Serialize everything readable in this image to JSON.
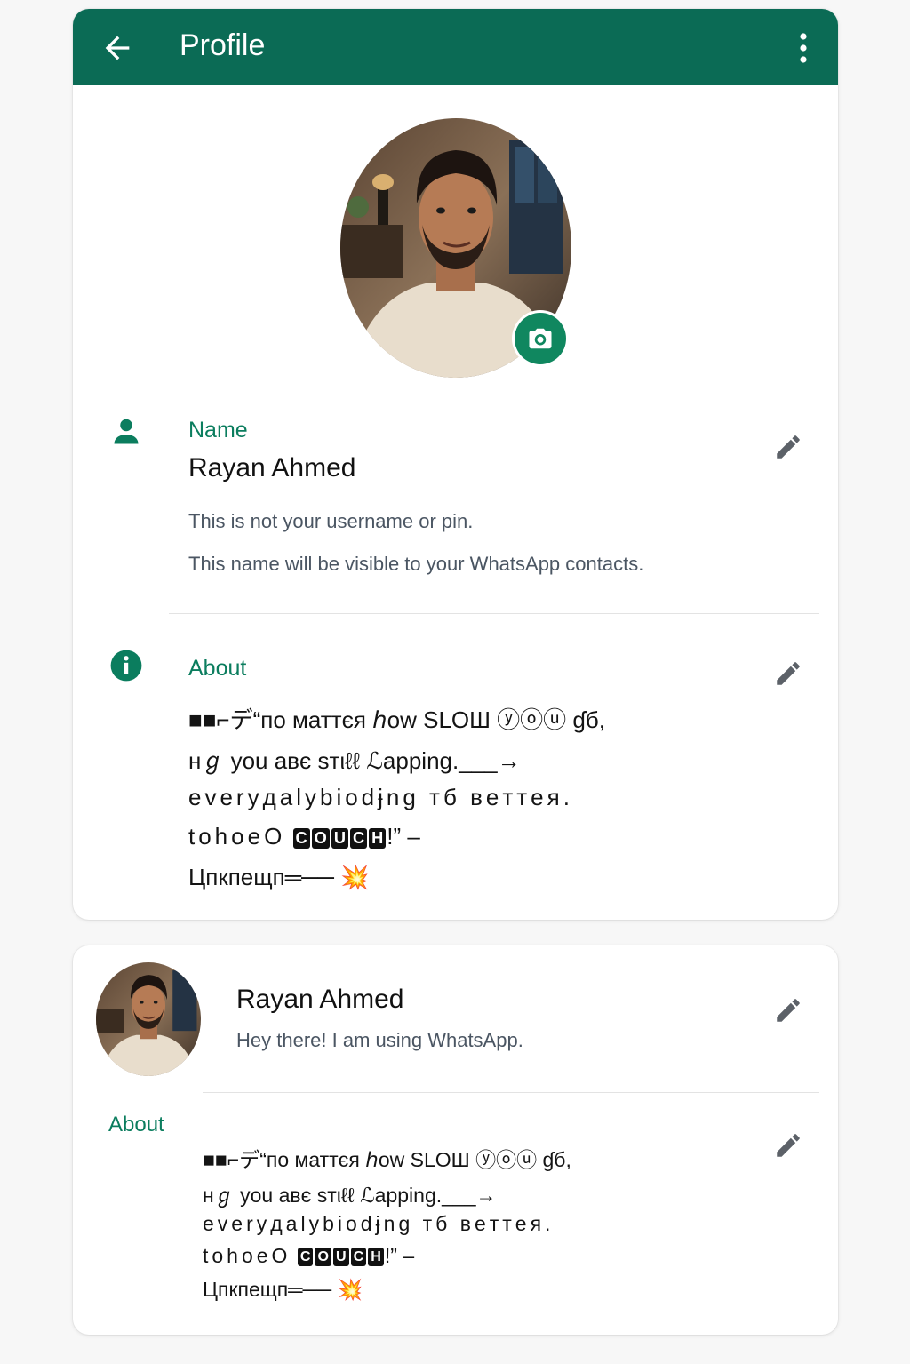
{
  "appbar": {
    "title": "Profile"
  },
  "colors": {
    "primary": "#0b6b55",
    "accent": "#10875f",
    "label": "#0b7d5e",
    "background": "#f7f7f7"
  },
  "icons": {
    "back": "arrow-left-icon",
    "more": "more-vertical-icon",
    "camera": "camera-icon",
    "person": "person-icon",
    "info": "info-icon",
    "edit": "pencil-icon",
    "burst": "explosion-icon"
  },
  "profile": {
    "name_label": "Name",
    "name": "Rayan Ahmed",
    "hint_line1": "This is not your username or pin.",
    "hint_line2": "This name will be visible to your WhatsApp contacts.",
    "about_label": "About",
    "about_lines": [
      "■■⌐デ“по маттєя ℎow SLOШ ⓨⓞⓤ ɠб,",
      "нℊ you авє ѕтιℓℓ ℒapping.___→",
      "everyдalybiodɉng тб вeттeя.",
      "tohoeO",
      "!” –",
      "Цпкпещп═──"
    ],
    "about_boxes": [
      "C",
      "O",
      "U",
      "C",
      "H"
    ],
    "about_emoji": "💥"
  },
  "card": {
    "name": "Rayan Ahmed",
    "status": "Hey there! I am using WhatsApp.",
    "about_label": "About"
  }
}
